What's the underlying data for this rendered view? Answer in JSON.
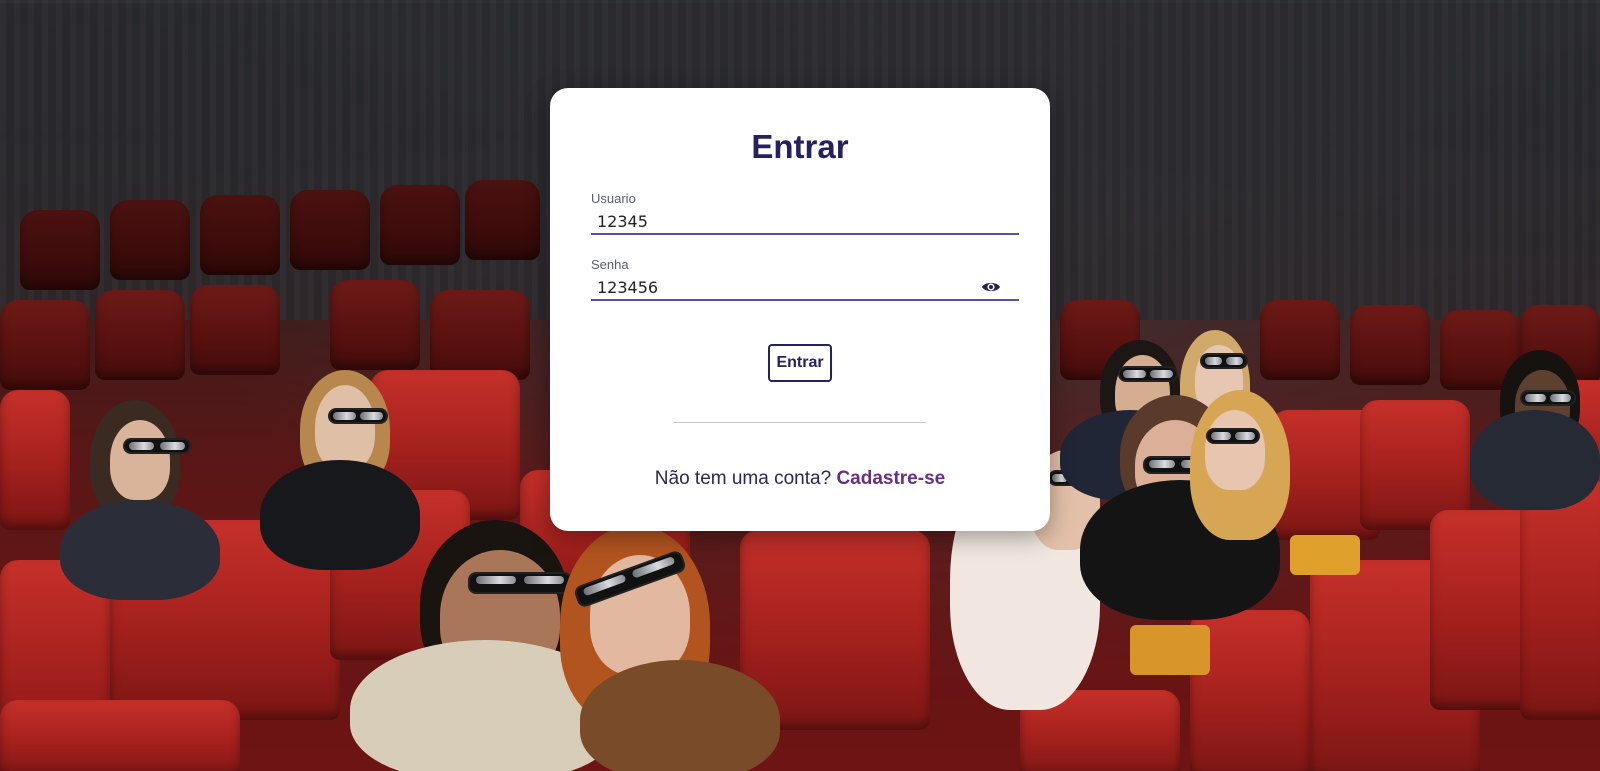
{
  "login": {
    "title": "Entrar",
    "username": {
      "label": "Usuario",
      "value": "12345"
    },
    "password": {
      "label": "Senha",
      "value": "123456",
      "toggle_icon": "eye-icon"
    },
    "submit_label": "Entrar",
    "signup_prompt": "Não tem uma conta?",
    "signup_link": "Cadastre-se"
  },
  "colors": {
    "title": "#25205f",
    "input_underline": "#5b4fa8",
    "link": "#6a2f82",
    "card_background": "#ffffff"
  }
}
